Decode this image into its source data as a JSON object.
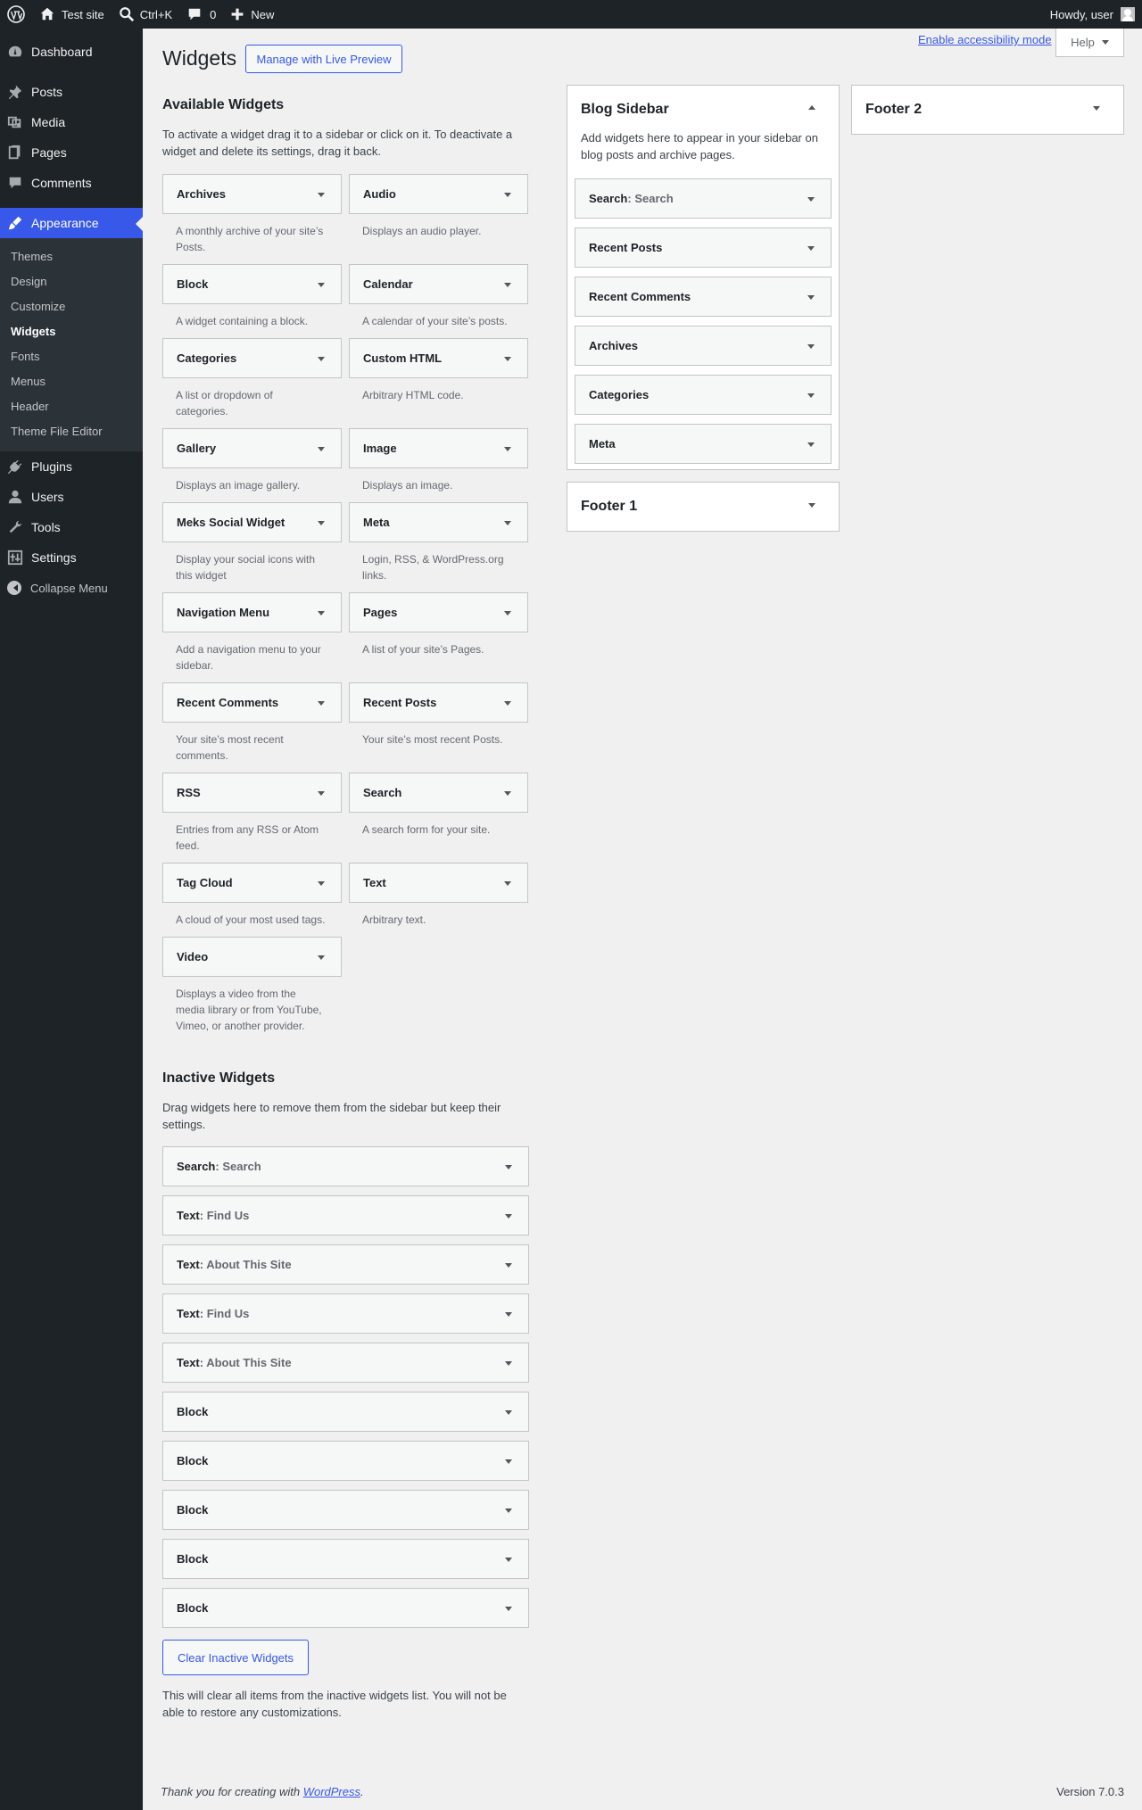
{
  "admin_bar": {
    "site_name": "Test site",
    "search_shortcut": "Ctrl+K",
    "comments_count": "0",
    "new_label": "New",
    "howdy": "Howdy, user"
  },
  "menu": {
    "dashboard": "Dashboard",
    "posts": "Posts",
    "media": "Media",
    "pages": "Pages",
    "comments": "Comments",
    "appearance": "Appearance",
    "appearance_sub": [
      "Themes",
      "Design",
      "Customize",
      "Widgets",
      "Fonts",
      "Menus",
      "Header",
      "Theme File Editor"
    ],
    "plugins": "Plugins",
    "users": "Users",
    "tools": "Tools",
    "settings": "Settings",
    "collapse": "Collapse Menu"
  },
  "header": {
    "title": "Widgets",
    "live_preview": "Manage with Live Preview",
    "a11y_link": "Enable accessibility mode",
    "help": "Help"
  },
  "available": {
    "title": "Available Widgets",
    "description": "To activate a widget drag it to a sidebar or click on it. To deactivate a widget and delete its settings, drag it back.",
    "widgets": [
      {
        "name": "Archives",
        "desc": "A monthly archive of your site’s Posts."
      },
      {
        "name": "Audio",
        "desc": "Displays an audio player."
      },
      {
        "name": "Block",
        "desc": "A widget containing a block."
      },
      {
        "name": "Calendar",
        "desc": "A calendar of your site’s posts."
      },
      {
        "name": "Categories",
        "desc": "A list or dropdown of categories."
      },
      {
        "name": "Custom HTML",
        "desc": "Arbitrary HTML code."
      },
      {
        "name": "Gallery",
        "desc": "Displays an image gallery."
      },
      {
        "name": "Image",
        "desc": "Displays an image."
      },
      {
        "name": "Meks Social Widget",
        "desc": "Display your social icons with this widget"
      },
      {
        "name": "Meta",
        "desc": "Login, RSS, & WordPress.org links."
      },
      {
        "name": "Navigation Menu",
        "desc": "Add a navigation menu to your sidebar."
      },
      {
        "name": "Pages",
        "desc": "A list of your site’s Pages."
      },
      {
        "name": "Recent Comments",
        "desc": "Your site’s most recent comments."
      },
      {
        "name": "Recent Posts",
        "desc": "Your site’s most recent Posts."
      },
      {
        "name": "RSS",
        "desc": "Entries from any RSS or Atom feed."
      },
      {
        "name": "Search",
        "desc": "A search form for your site."
      },
      {
        "name": "Tag Cloud",
        "desc": "A cloud of your most used tags."
      },
      {
        "name": "Text",
        "desc": "Arbitrary text."
      },
      {
        "name": "Video",
        "desc": "Displays a video from the media library or from YouTube, Vimeo, or another provider."
      }
    ]
  },
  "inactive": {
    "title": "Inactive Widgets",
    "description": "Drag widgets here to remove them from the sidebar but keep their settings.",
    "widgets": [
      {
        "name": "Search",
        "title": "Search"
      },
      {
        "name": "Text",
        "title": "Find Us"
      },
      {
        "name": "Text",
        "title": "About This Site"
      },
      {
        "name": "Text",
        "title": "Find Us"
      },
      {
        "name": "Text",
        "title": "About This Site"
      },
      {
        "name": "Block",
        "title": ""
      },
      {
        "name": "Block",
        "title": ""
      },
      {
        "name": "Block",
        "title": ""
      },
      {
        "name": "Block",
        "title": ""
      },
      {
        "name": "Block",
        "title": ""
      }
    ],
    "clear_button": "Clear Inactive Widgets",
    "clear_note": "This will clear all items from the inactive widgets list. You will not be able to restore any customizations."
  },
  "blog_sidebar": {
    "title": "Blog Sidebar",
    "description": "Add widgets here to appear in your sidebar on blog posts and archive pages.",
    "widgets": [
      {
        "name": "Search",
        "title": "Search"
      },
      {
        "name": "Recent Posts",
        "title": ""
      },
      {
        "name": "Recent Comments",
        "title": ""
      },
      {
        "name": "Archives",
        "title": ""
      },
      {
        "name": "Categories",
        "title": ""
      },
      {
        "name": "Meta",
        "title": ""
      }
    ]
  },
  "footer1": {
    "title": "Footer 1"
  },
  "footer2": {
    "title": "Footer 2"
  },
  "footer": {
    "thanks_prefix": "Thank you for creating with ",
    "wordpress_link": "WordPress",
    "thanks_suffix": ".",
    "version": "Version 7.0.3"
  }
}
